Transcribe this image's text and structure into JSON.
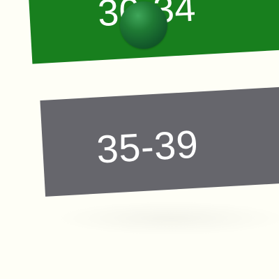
{
  "age_options": [
    {
      "label": "30-34",
      "color": "#187F1E",
      "state": "hovered"
    },
    {
      "label": "35-39",
      "color": "#66666C",
      "state": "default"
    }
  ],
  "pointer": {
    "icon": "sphere-pointer-icon",
    "color": "#1A7030"
  },
  "background_color": "#FEFEF6"
}
